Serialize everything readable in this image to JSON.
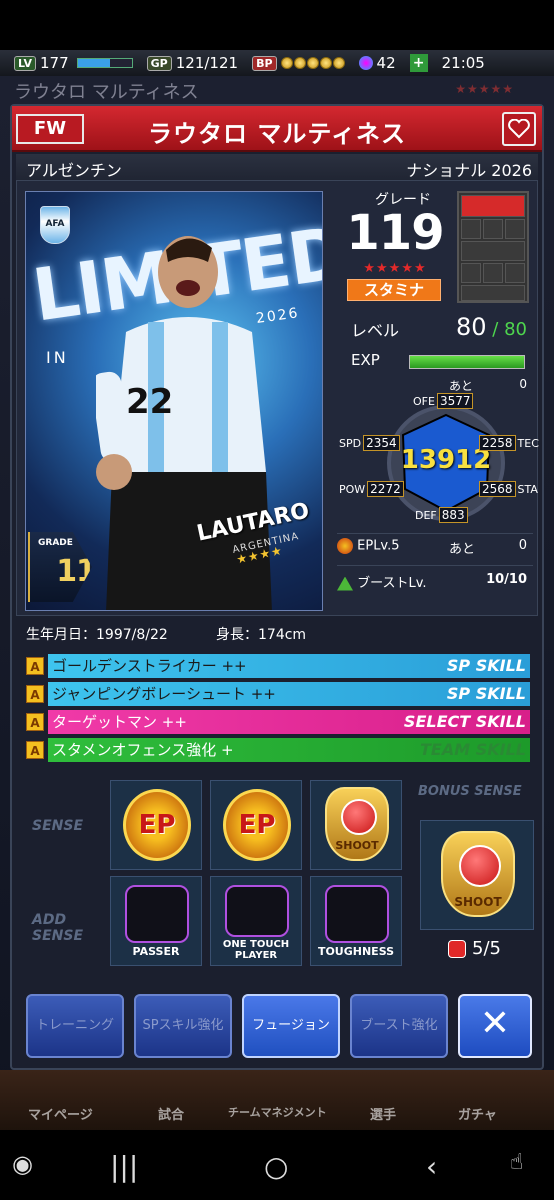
{
  "status": {
    "level_badge": "LV",
    "level": "177",
    "gp_badge": "GP",
    "gp": "121/121",
    "bp_badge": "BP",
    "gems": "42",
    "time": "21:05"
  },
  "background": {
    "title": "ラウタロ マルティネス",
    "stars": "★★★★★"
  },
  "player": {
    "position": "FW",
    "name": "ラウタロ マルティネス",
    "nation": "アルゼンチン",
    "edition": "ナショナル 2026",
    "card_text": "LIMITED",
    "card_in": "IN",
    "card_year": "2026",
    "card_name": "LAUTARO",
    "card_nation": "ARGENTINA",
    "card_stars": "★★★★",
    "shirt_number": "22",
    "card_grade_label": "GRADE",
    "card_grade": "119",
    "birth": "生年月日：1997/8/22",
    "height": "身長：174cm"
  },
  "stats": {
    "grade_label": "グレード",
    "grade": "119",
    "grade_stars": "★★★★★",
    "type": "スタミナ",
    "level_label": "レベル",
    "level": "80",
    "level_sep": " / ",
    "level_max": "80",
    "exp_label": "EXP",
    "remain_label": "あと",
    "remain_value": "0",
    "exp_fill": 1.0,
    "overall": "13912",
    "ofe_label": "OFE",
    "ofe": "3577",
    "spd_label": "SPD",
    "spd": "2354",
    "tec_label": "TEC",
    "tec": "2258",
    "pow_label": "POW",
    "pow": "2272",
    "sta_label": "STA",
    "sta": "2568",
    "def_label": "DEF",
    "def": "883",
    "epl_label": "EPLv.5",
    "epl_remain_label": "あと",
    "epl_remain": "0",
    "boost_label": "ブーストLv.",
    "boost_value": "10/10"
  },
  "skills": [
    {
      "rank": "A",
      "name": "ゴールデンストライカー ++",
      "type": "SP SKILL",
      "kind": "sp"
    },
    {
      "rank": "A",
      "name": "ジャンピングボレーシュート ++",
      "type": "SP SKILL",
      "kind": "sp"
    },
    {
      "rank": "A",
      "name": "ターゲットマン ++",
      "type": "SELECT SKILL",
      "kind": "sel"
    },
    {
      "rank": "A",
      "name": "スタメンオフェンス強化 +",
      "type": "TEAM SKILL",
      "kind": "team"
    }
  ],
  "sense": {
    "sense_label": "SENSE",
    "add_label": "ADD SENSE",
    "slot1": "EP",
    "slot2": "EP",
    "slot3": "SHOOT",
    "add1": "PASSER",
    "add2": "ONE TOUCH PLAYER",
    "add3": "TOUGHNESS",
    "bonus_label": "BONUS SENSE",
    "bonus": "SHOOT",
    "bonus_count": "5/5"
  },
  "buttons": {
    "training": "トレーニング",
    "sp_enhance": "SPスキル強化",
    "fusion": "フュージョン",
    "boost_enhance": "ブースト強化",
    "close": "✕"
  },
  "bottom_menu": [
    "マイページ",
    "試合",
    "チームマネジメント",
    "選手",
    "ガチャ"
  ],
  "colors": {
    "title_red": "#c8202a",
    "sp_skill": "#3ec4ee",
    "select_skill": "#f03aa8",
    "team_skill": "#2fbe3c",
    "overall_gold": "#f8e040"
  }
}
